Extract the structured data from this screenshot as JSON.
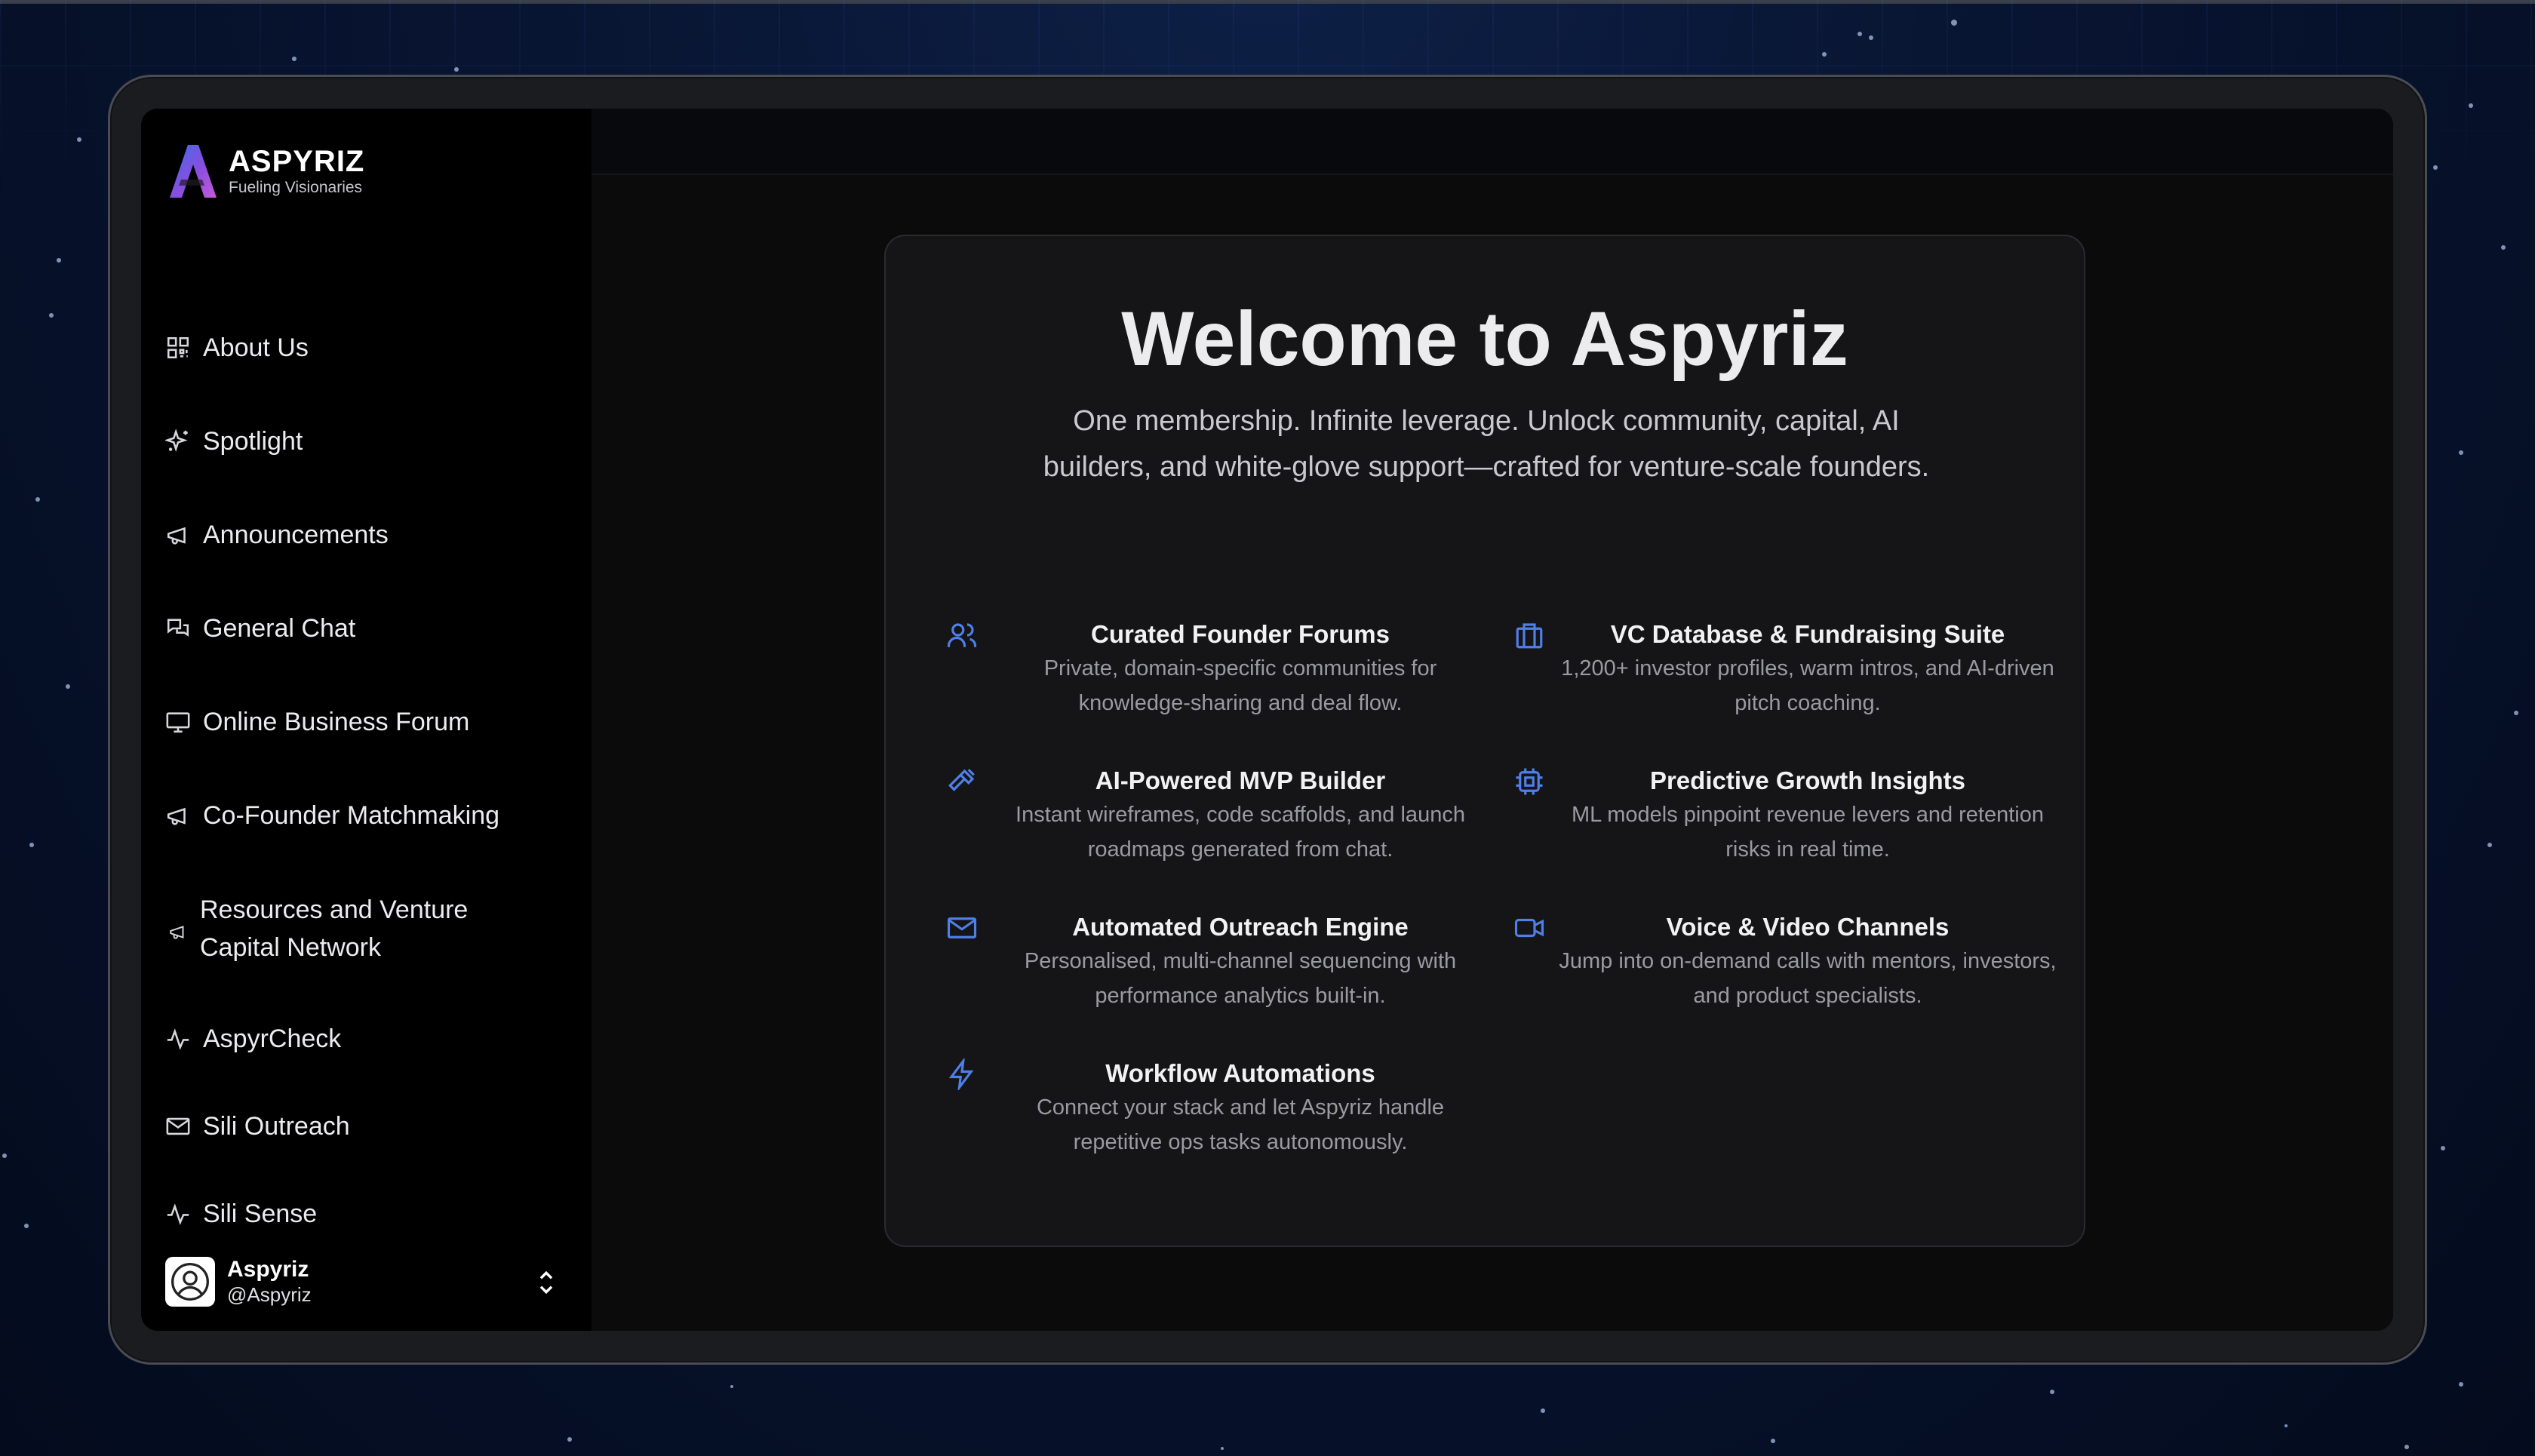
{
  "brand": {
    "name": "ASPYRIZ",
    "tagline": "Fueling Visionaries"
  },
  "sidebar": {
    "items": [
      {
        "label": "About Us",
        "icon": "qr-grid-icon"
      },
      {
        "label": "Spotlight",
        "icon": "sparkle-icon"
      },
      {
        "label": "Announcements",
        "icon": "megaphone-icon"
      },
      {
        "label": "General Chat",
        "icon": "chat-bubbles-icon"
      },
      {
        "label": "Online Business Forum",
        "icon": "monitor-icon"
      },
      {
        "label": "Co-Founder Matchmaking",
        "icon": "megaphone-icon"
      },
      {
        "label": "Resources and Venture Capital Network",
        "label_line1": "Resources and Venture",
        "label_line2": "Capital Network",
        "icon": "megaphone-icon"
      },
      {
        "label": "AspyrCheck",
        "icon": "activity-icon"
      },
      {
        "label": "Sili Outreach",
        "icon": "mail-icon"
      },
      {
        "label": "Sili Sense",
        "icon": "activity-icon"
      }
    ]
  },
  "user": {
    "name": "Aspyriz",
    "handle": "@Aspyriz"
  },
  "main": {
    "title": "Welcome to Aspyriz",
    "subtitle": "One membership. Infinite leverage. Unlock community, capital, AI builders, and white-glove support—crafted for venture-scale founders.",
    "features": [
      {
        "title": "Curated Founder Forums",
        "desc": "Private, domain-specific communities for knowledge-sharing and deal flow.",
        "icon": "users-icon"
      },
      {
        "title": "VC Database & Fundraising Suite",
        "desc": "1,200+ investor profiles, warm intros, and AI-driven pitch coaching.",
        "icon": "briefcase-icon"
      },
      {
        "title": "AI-Powered MVP Builder",
        "desc": "Instant wireframes, code scaffolds, and launch roadmaps generated from chat.",
        "icon": "hammer-icon"
      },
      {
        "title": "Predictive Growth Insights",
        "desc": "ML models pinpoint revenue levers and retention risks in real time.",
        "icon": "cpu-icon"
      },
      {
        "title": "Automated Outreach Engine",
        "desc": "Personalised, multi-channel sequencing with performance analytics built-in.",
        "icon": "mail-icon"
      },
      {
        "title": "Voice & Video Channels",
        "desc": "Jump into on-demand calls with mentors, investors, and product specialists.",
        "icon": "video-icon"
      },
      {
        "title": "Workflow Automations",
        "desc": "Connect your stack and let Aspyriz handle repetitive ops tasks autonomously.",
        "icon": "zap-icon"
      }
    ]
  },
  "colors": {
    "accent": "#4f7fe8",
    "background": "#06112a",
    "card": "#151517",
    "sidebar": "#000000"
  }
}
